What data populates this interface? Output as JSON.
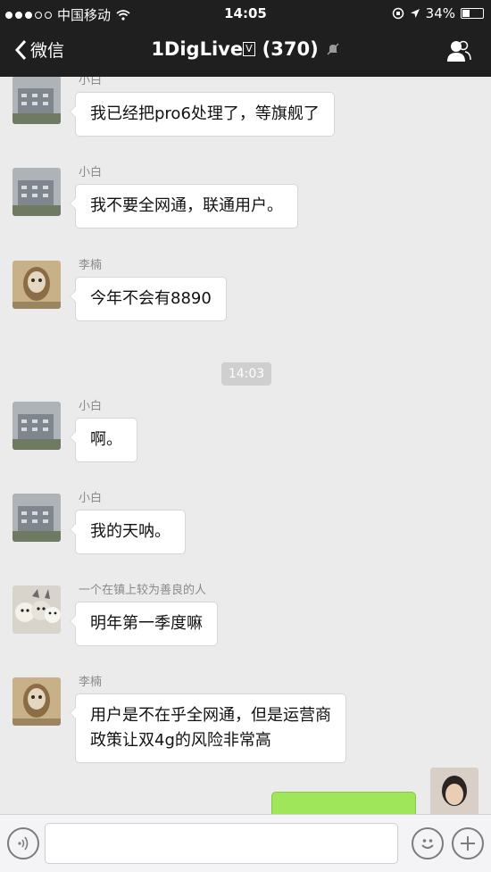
{
  "status_bar": {
    "carrier": "中国移动",
    "time": "14:05",
    "battery": "34%",
    "signal_dots_filled": 3,
    "signal_dots_total": 5
  },
  "nav": {
    "back_label": "微信",
    "title": "1DigLive",
    "title_badge": "V",
    "member_count": "(370)"
  },
  "messages": [
    {
      "sender": "小白",
      "text": "我已经把pro6处理了，等旗舰了",
      "avatar": "building-photo-avatar"
    },
    {
      "sender": "小白",
      "text": "我不要全网通，联通用户。",
      "avatar": "building-photo-avatar"
    },
    {
      "sender": "李楠",
      "text": "今年不会有8890",
      "avatar": "figurine-avatar"
    },
    {
      "sender": "小白",
      "text": "啊。",
      "avatar": "building-photo-avatar"
    },
    {
      "sender": "小白",
      "text": "我的天呐。",
      "avatar": "building-photo-avatar"
    },
    {
      "sender": "一个在镇上较为善良的人",
      "text": "明年第一季度嘛",
      "avatar": "dogs-photo-avatar"
    },
    {
      "sender": "李楠",
      "text": "用户是不在乎全网通，但是运营商\n政策让双4g的风险非常高",
      "avatar": "figurine-avatar"
    }
  ],
  "time_divider": "14:03",
  "colors": {
    "header_bg": "#1f1f1f",
    "chat_bg": "#ebebeb",
    "my_bubble": "#9fe65a",
    "their_bubble": "#ffffff"
  }
}
